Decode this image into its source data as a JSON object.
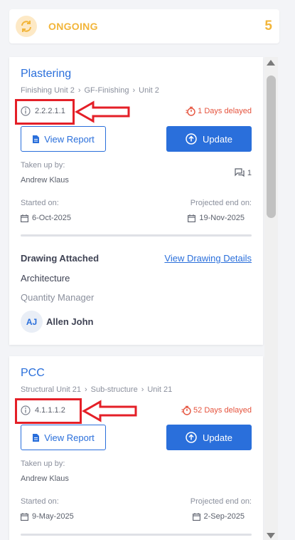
{
  "header": {
    "title": "ONGOING",
    "count": "5",
    "icon": "sync-icon"
  },
  "tasks": [
    {
      "title": "Plastering",
      "breadcrumb": [
        "Finishing Unit 2",
        "GF-Finishing",
        "Unit 2"
      ],
      "code": "2.2.2.1.1",
      "delay": "1 Days delayed",
      "view_report_label": "View Report",
      "update_label": "Update",
      "taken_up_label": "Taken up by:",
      "taken_up_by": "Andrew Klaus",
      "comment_count": "1",
      "started_label": "Started on:",
      "started_on": "6-Oct-2025",
      "projected_label": "Projected end on:",
      "projected_end": "19-Nov-2025",
      "drawing_label": "Drawing Attached",
      "drawing_link": "View Drawing Details",
      "discipline": "Architecture",
      "role": "Quantity Manager",
      "assignee_initials": "AJ",
      "assignee_name": "Allen John"
    },
    {
      "title": "PCC",
      "breadcrumb": [
        "Structural Unit 21",
        "Sub-structure",
        "Unit 21"
      ],
      "code": "4.1.1.1.2",
      "delay": "52 Days delayed",
      "view_report_label": "View Report",
      "update_label": "Update",
      "taken_up_label": "Taken up by:",
      "taken_up_by": "Andrew Klaus",
      "started_label": "Started on:",
      "started_on": "9-May-2025",
      "projected_label": "Projected end on:",
      "projected_end": "2-Sep-2025"
    }
  ],
  "colors": {
    "accent": "#2a6fdb",
    "ongoing": "#f2b53a",
    "delay": "#e5533d",
    "annotation": "#e41f27"
  }
}
